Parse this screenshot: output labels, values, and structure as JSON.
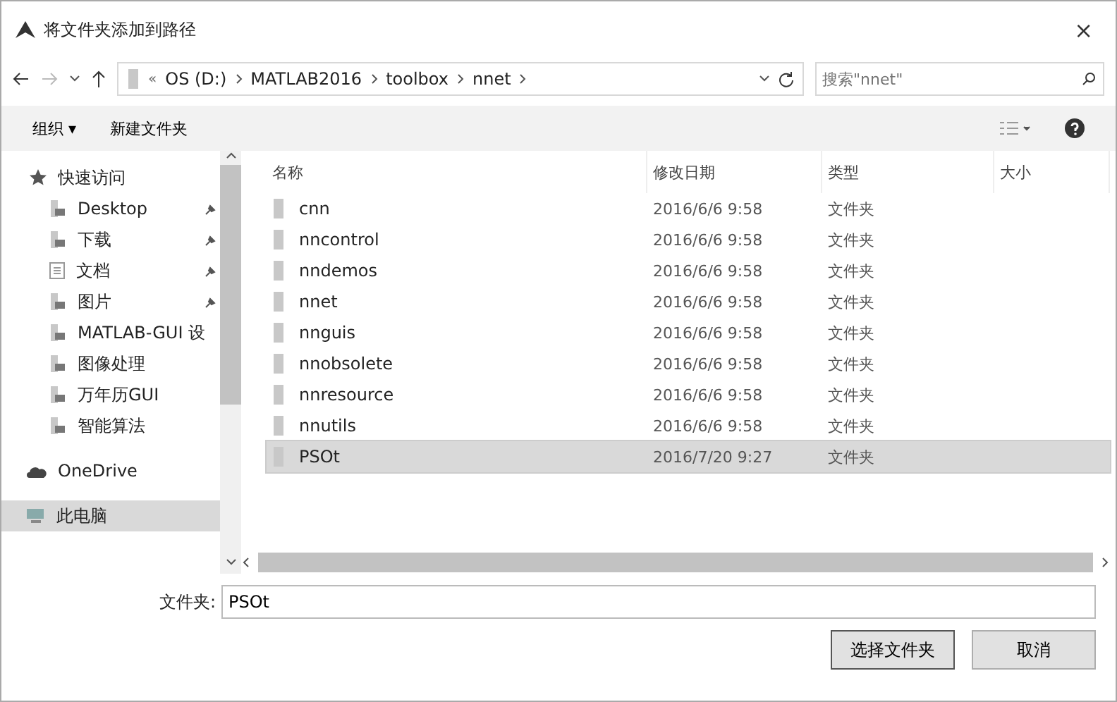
{
  "window": {
    "title": "将文件夹添加到路径",
    "close": "×"
  },
  "address_bar": {
    "overflow": "«",
    "segments": [
      "OS (D:)",
      "MATLAB2016",
      "toolbox",
      "nnet"
    ]
  },
  "search": {
    "placeholder": "搜索\"nnet\""
  },
  "toolbar": {
    "organize": "组织 ▾",
    "new_folder": "新建文件夹"
  },
  "sidebar": {
    "items": [
      {
        "label": "快速访问",
        "kind": "star",
        "selected": false,
        "children": [
          {
            "label": "Desktop",
            "kind": "folder",
            "pinned": true,
            "selected": false
          },
          {
            "label": "下载",
            "kind": "folder",
            "pinned": true,
            "selected": false
          },
          {
            "label": "文档",
            "kind": "doc",
            "pinned": true,
            "selected": false
          },
          {
            "label": "图片",
            "kind": "folder",
            "pinned": true,
            "selected": false
          },
          {
            "label": "MATLAB-GUI 设",
            "kind": "folder",
            "pinned": false,
            "selected": false
          },
          {
            "label": "图像处理",
            "kind": "folder",
            "pinned": false,
            "selected": false
          },
          {
            "label": "万年历GUI",
            "kind": "folder",
            "pinned": false,
            "selected": false
          },
          {
            "label": "智能算法",
            "kind": "folder",
            "pinned": false,
            "selected": false
          }
        ]
      },
      {
        "label": "OneDrive",
        "kind": "cloud",
        "selected": false
      },
      {
        "label": "此电脑",
        "kind": "pc",
        "selected": true
      }
    ]
  },
  "table": {
    "columns": [
      "名称",
      "修改日期",
      "类型",
      "大小"
    ],
    "rows": [
      {
        "name": "cnn",
        "modified": "2016/6/6 9:58",
        "type": "文件夹",
        "selected": false
      },
      {
        "name": "nncontrol",
        "modified": "2016/6/6 9:58",
        "type": "文件夹",
        "selected": false
      },
      {
        "name": "nndemos",
        "modified": "2016/6/6 9:58",
        "type": "文件夹",
        "selected": false
      },
      {
        "name": "nnet",
        "modified": "2016/6/6 9:58",
        "type": "文件夹",
        "selected": false
      },
      {
        "name": "nnguis",
        "modified": "2016/6/6 9:58",
        "type": "文件夹",
        "selected": false
      },
      {
        "name": "nnobsolete",
        "modified": "2016/6/6 9:58",
        "type": "文件夹",
        "selected": false
      },
      {
        "name": "nnresource",
        "modified": "2016/6/6 9:58",
        "type": "文件夹",
        "selected": false
      },
      {
        "name": "nnutils",
        "modified": "2016/6/6 9:58",
        "type": "文件夹",
        "selected": false
      },
      {
        "name": "PSOt",
        "modified": "2016/7/20 9:27",
        "type": "文件夹",
        "selected": true
      }
    ]
  },
  "folder_field": {
    "label": "文件夹:",
    "value": "PSOt"
  },
  "buttons": [
    "选择文件夹",
    "取消"
  ]
}
